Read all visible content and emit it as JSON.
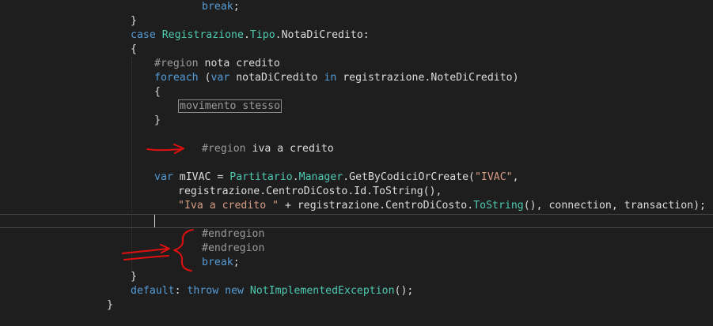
{
  "code_lines": [
    {
      "id": "l1",
      "tokens": [
        {
          "t": "break",
          "c": "kw"
        },
        {
          "t": ";",
          "c": ""
        }
      ]
    },
    {
      "id": "l2",
      "tokens": [
        {
          "t": "}",
          "c": ""
        }
      ]
    },
    {
      "id": "l3",
      "tokens": [
        {
          "t": "case",
          "c": "kw"
        },
        {
          "t": " ",
          "c": ""
        },
        {
          "t": "Registrazione",
          "c": "ty"
        },
        {
          "t": ".",
          "c": ""
        },
        {
          "t": "Tipo",
          "c": "ty"
        },
        {
          "t": ".NotaDiCredito:",
          "c": ""
        }
      ]
    },
    {
      "id": "l4",
      "tokens": [
        {
          "t": "{",
          "c": ""
        }
      ]
    },
    {
      "id": "l5",
      "tokens": [
        {
          "t": "#region",
          "c": "pp"
        },
        {
          "t": " nota credito",
          "c": ""
        }
      ]
    },
    {
      "id": "l6",
      "tokens": [
        {
          "t": "foreach",
          "c": "kw"
        },
        {
          "t": " (",
          "c": ""
        },
        {
          "t": "var",
          "c": "kw"
        },
        {
          "t": " notaDiCredito ",
          "c": ""
        },
        {
          "t": "in",
          "c": "kw"
        },
        {
          "t": " registrazione.NoteDiCredito)",
          "c": ""
        }
      ]
    },
    {
      "id": "l7",
      "tokens": [
        {
          "t": "{",
          "c": ""
        }
      ]
    },
    {
      "id": "l8",
      "tokens": [
        {
          "t": "movimento stesso",
          "c": "box"
        }
      ]
    },
    {
      "id": "l9",
      "tokens": [
        {
          "t": "}",
          "c": ""
        }
      ]
    },
    {
      "id": "l10",
      "tokens": []
    },
    {
      "id": "l11",
      "tokens": [
        {
          "t": "#region",
          "c": "pp"
        },
        {
          "t": " iva a credito",
          "c": ""
        }
      ]
    },
    {
      "id": "l12",
      "tokens": []
    },
    {
      "id": "l13",
      "tokens": [
        {
          "t": "var",
          "c": "kw"
        },
        {
          "t": " mIVAC = ",
          "c": ""
        },
        {
          "t": "Partitario",
          "c": "ty"
        },
        {
          "t": ".",
          "c": ""
        },
        {
          "t": "Manager",
          "c": "ty"
        },
        {
          "t": ".GetByCodiciOrCreate(",
          "c": ""
        },
        {
          "t": "\"IVAC\"",
          "c": "st"
        },
        {
          "t": ",",
          "c": ""
        }
      ]
    },
    {
      "id": "l14",
      "tokens": [
        {
          "t": "registrazione.CentroDiCosto.Id.ToString(),",
          "c": ""
        }
      ]
    },
    {
      "id": "l15",
      "tokens": [
        {
          "t": "\"Iva a credito \"",
          "c": "st"
        },
        {
          "t": " + registrazione.CentroDiCosto.",
          "c": ""
        },
        {
          "t": "ToString",
          "c": "ty"
        },
        {
          "t": "(), connection, transaction);",
          "c": ""
        }
      ]
    },
    {
      "id": "l16",
      "tokens": []
    },
    {
      "id": "l17",
      "tokens": [
        {
          "t": "#endregion",
          "c": "pp"
        }
      ]
    },
    {
      "id": "l18",
      "tokens": [
        {
          "t": "#endregion",
          "c": "pp"
        }
      ]
    },
    {
      "id": "l19",
      "tokens": [
        {
          "t": "break",
          "c": "kw"
        },
        {
          "t": ";",
          "c": ""
        }
      ]
    },
    {
      "id": "l20",
      "tokens": [
        {
          "t": "}",
          "c": ""
        }
      ]
    },
    {
      "id": "l21",
      "tokens": [
        {
          "t": "default",
          "c": "kw"
        },
        {
          "t": ": ",
          "c": ""
        },
        {
          "t": "throw",
          "c": "kw"
        },
        {
          "t": " ",
          "c": ""
        },
        {
          "t": "new",
          "c": "kw"
        },
        {
          "t": " ",
          "c": ""
        },
        {
          "t": "NotImplementedException",
          "c": "ty"
        },
        {
          "t": "();",
          "c": ""
        }
      ]
    },
    {
      "id": "l22",
      "tokens": [
        {
          "t": "}",
          "c": ""
        }
      ]
    }
  ],
  "colors": {
    "background": "#1e1e1e",
    "text": "#dcdcdc",
    "keyword": "#569cd6",
    "type": "#4ec9b0",
    "string": "#d69d85",
    "preprocessor": "#9b9b9b",
    "annotation": "#e01010"
  }
}
